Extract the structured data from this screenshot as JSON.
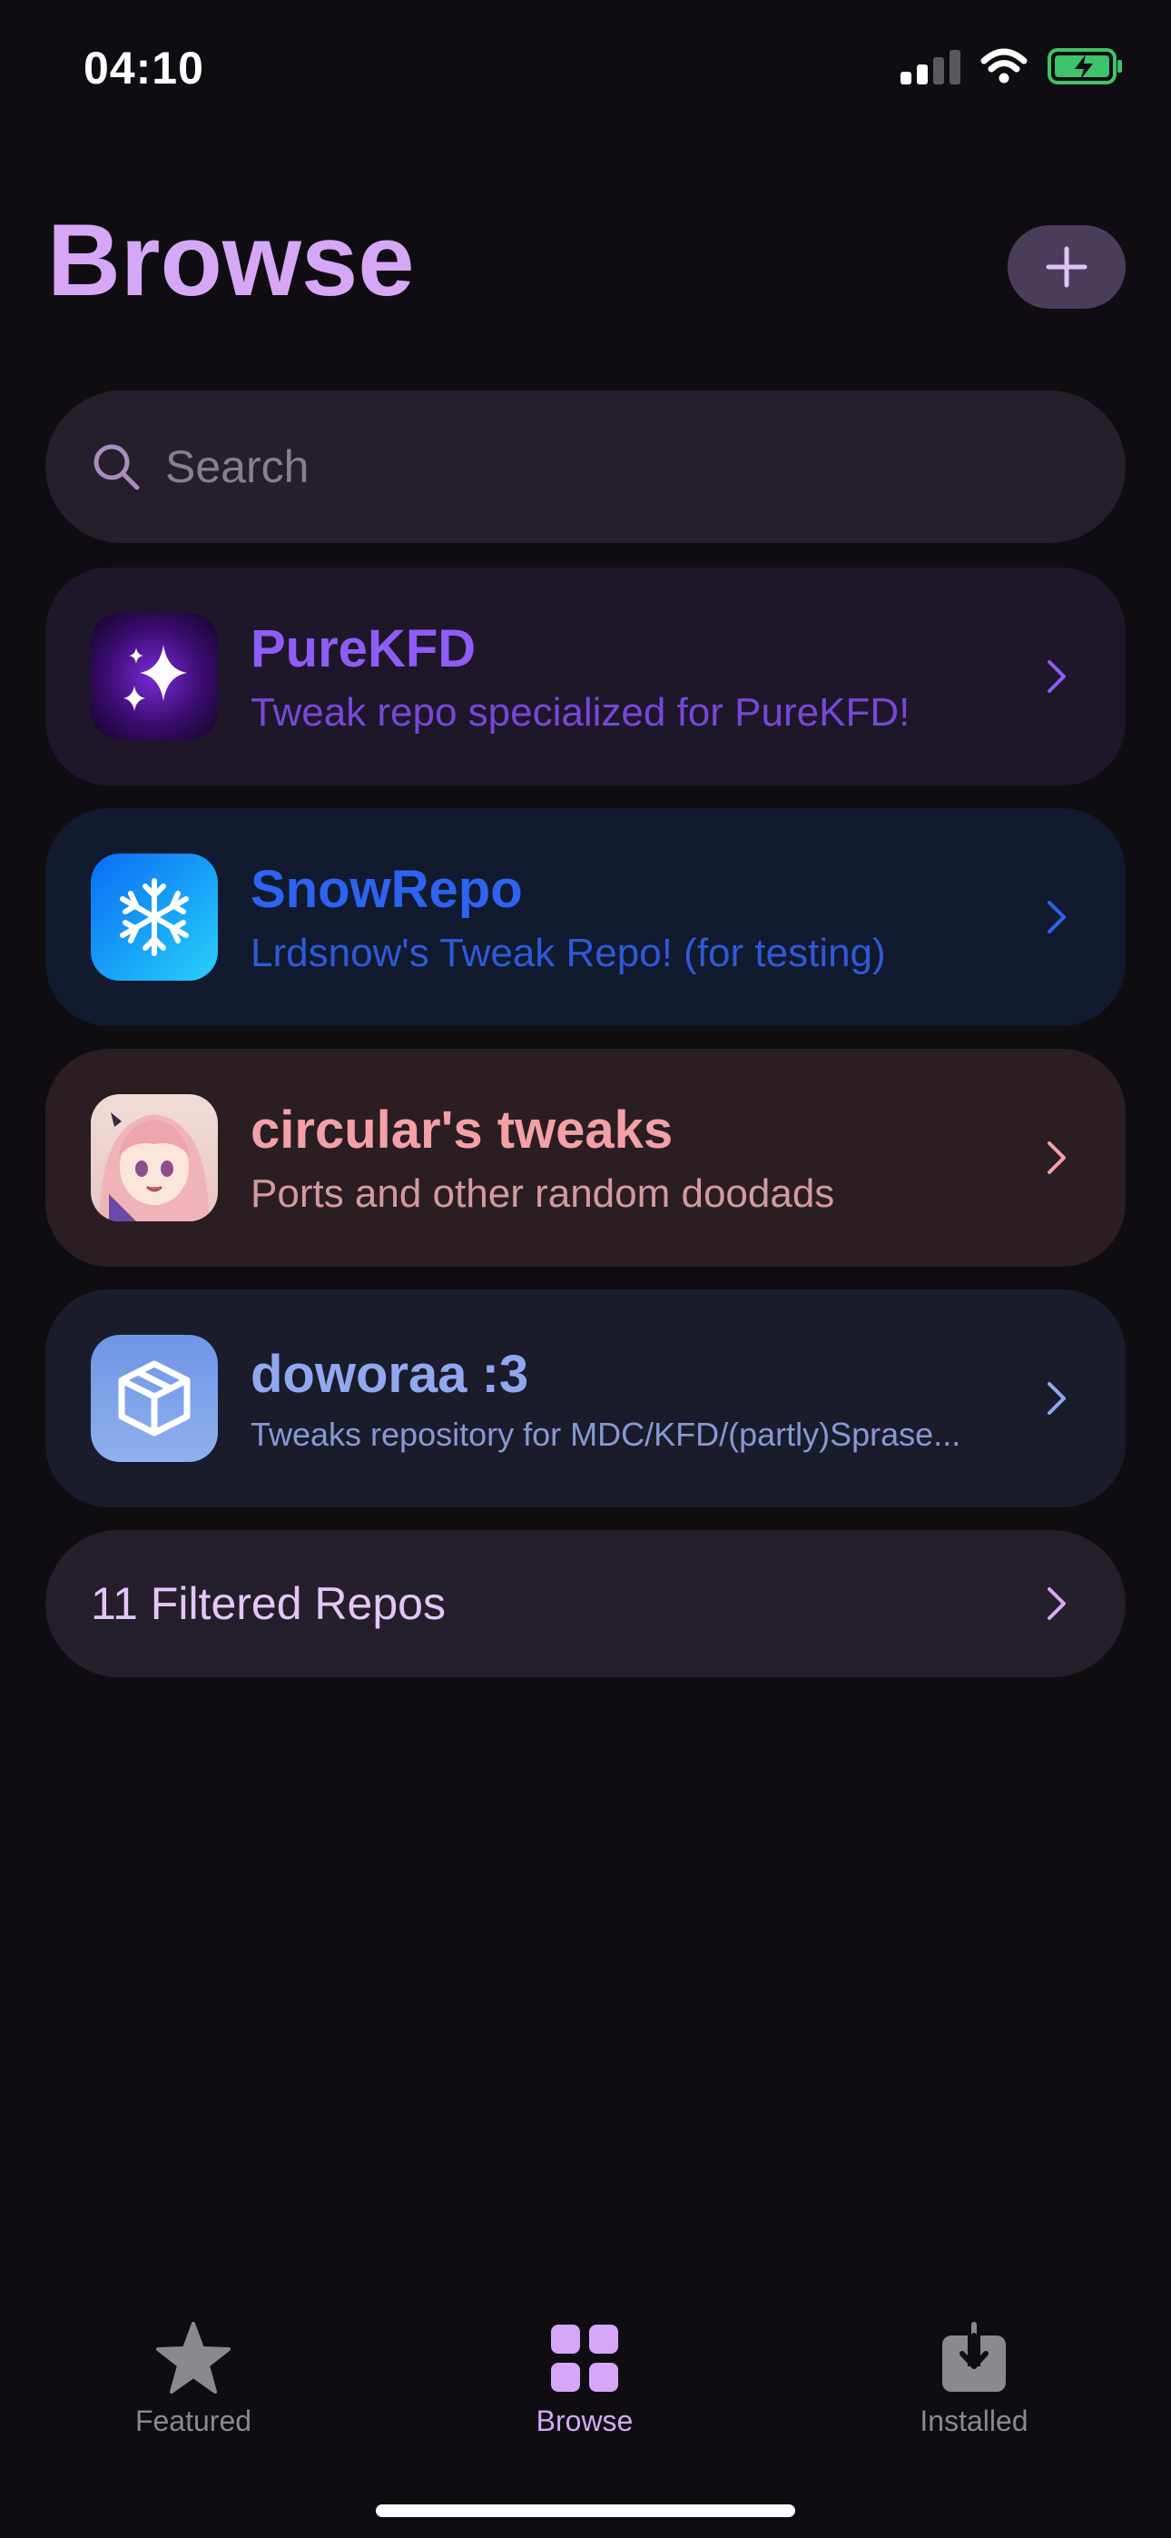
{
  "status": {
    "time": "04:10"
  },
  "header": {
    "title": "Browse"
  },
  "search": {
    "placeholder": "Search"
  },
  "repos": [
    {
      "name": "PureKFD",
      "description": "Tweak repo specialized for PureKFD!",
      "name_color": "#8e5cf6",
      "desc_color": "#7648d8",
      "bg": "#1e1729"
    },
    {
      "name": "SnowRepo",
      "description": "Lrdsnow's Tweak Repo! (for testing)",
      "name_color": "#2c63f0",
      "desc_color": "#2d5ad8",
      "bg": "#111a2e"
    },
    {
      "name": "circular's tweaks",
      "description": "Ports and other random doodads",
      "name_color": "#f4a0a6",
      "desc_color": "#d49a9e",
      "bg": "#2a1e23"
    },
    {
      "name": "doworaa :3",
      "description": "Tweaks repository for MDC/KFD/(partly)Sprase...",
      "name_color": "#8fa8ef",
      "desc_color": "#8799d4",
      "bg": "#1b1c2b"
    }
  ],
  "filtered": {
    "label": "11 Filtered Repos"
  },
  "tabs": [
    {
      "label": "Featured",
      "active": false
    },
    {
      "label": "Browse",
      "active": true
    },
    {
      "label": "Installed",
      "active": false
    }
  ],
  "colors": {
    "accent": "#d7a7f7",
    "inactive": "#8a8a8e"
  }
}
